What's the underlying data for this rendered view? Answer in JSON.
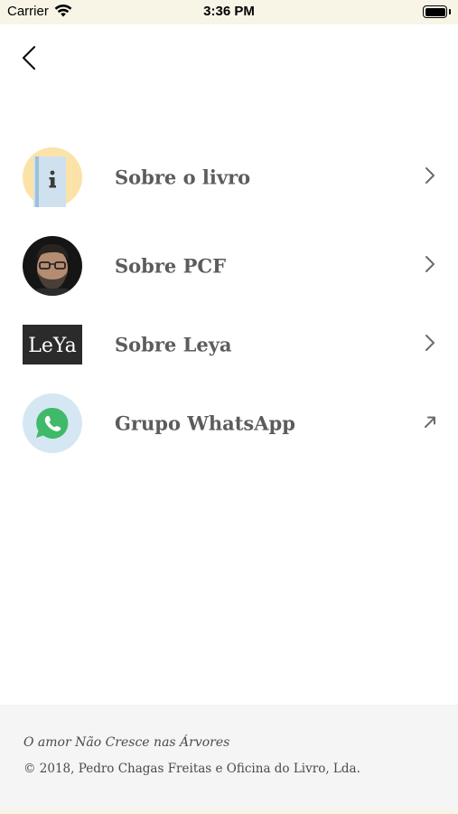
{
  "status_bar": {
    "carrier": "Carrier",
    "time": "3:36 PM",
    "battery_level": 1.0
  },
  "nav": {
    "back_icon": "chevron-left-icon"
  },
  "menu": {
    "items": [
      {
        "label": "Sobre o livro",
        "icon": "book-info-icon",
        "action_icon": "chevron-right-icon"
      },
      {
        "label": "Sobre PCF",
        "icon": "author-avatar",
        "action_icon": "chevron-right-icon"
      },
      {
        "label": "Sobre Leya",
        "icon": "leya-logo",
        "logo_text": "LeYa",
        "action_icon": "chevron-right-icon"
      },
      {
        "label": "Grupo WhatsApp",
        "icon": "whatsapp-icon",
        "action_icon": "external-link-icon"
      }
    ]
  },
  "footer": {
    "title": "O amor Não Cresce nas Árvores",
    "copyright": "© 2018, Pedro Chagas Freitas e Oficina do Livro, Lda."
  },
  "colors": {
    "status_bar_bg": "#f8f5e7",
    "label_text": "#5c5c5c",
    "chevron": "#6b6b6b",
    "footer_bg": "#f5f5f5",
    "book_icon_bg": "#fbe3a8",
    "book_cover": "#cfe1ee",
    "whatsapp_circle": "#d5e7f2",
    "whatsapp_green": "#3fb96a",
    "leya_bg": "#2b2b2b"
  }
}
